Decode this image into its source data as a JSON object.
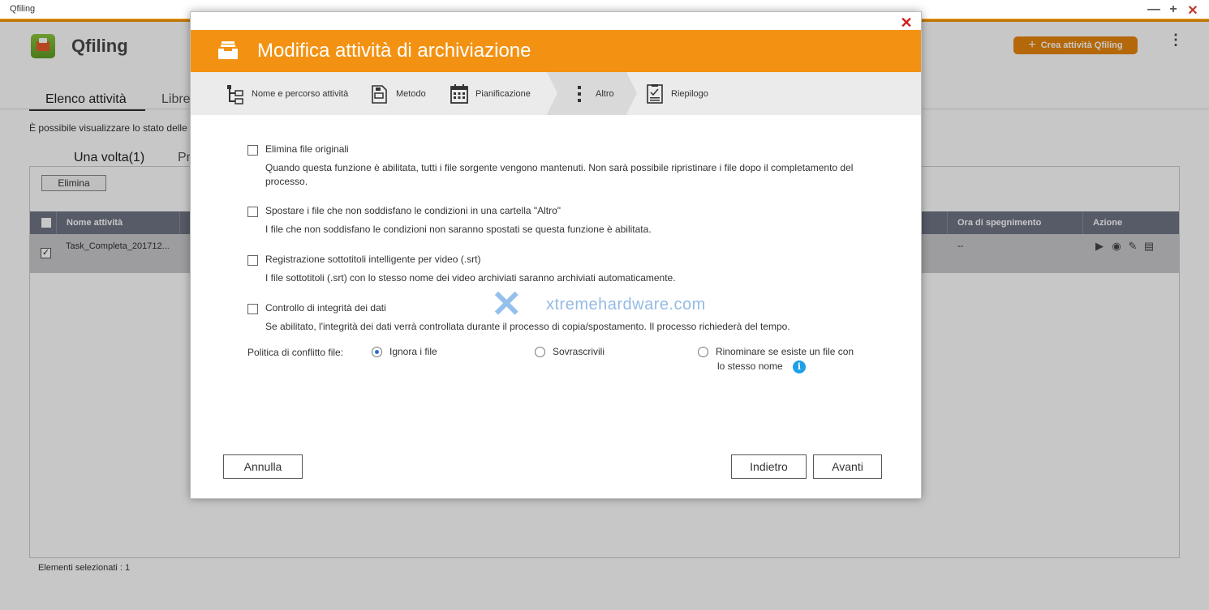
{
  "window": {
    "title": "Qfiling",
    "controls": {
      "minimize": "—",
      "maximize": "+",
      "close": "✕"
    }
  },
  "app": {
    "name": "Qfiling",
    "create_button": "Crea attività Qfiling",
    "main_tabs": [
      "Elenco attività",
      "Libre"
    ],
    "info_text": "È possibile visualizzare lo stato delle",
    "sub_tabs": [
      "Una volta(1)",
      "Pr"
    ],
    "delete_button": "Elimina",
    "table": {
      "columns": [
        "Nome attività",
        "Ora di spegnimento",
        "Azione"
      ],
      "rows": [
        {
          "name": "Task_Completa_201712...",
          "shutdown_time": "--",
          "checked": true
        }
      ]
    },
    "status": "Elementi selezionati : 1"
  },
  "dialog": {
    "title": "Modifica attività di archiviazione",
    "close": "✕",
    "steps": [
      {
        "label": "Nome e percorso attività",
        "icon": "folder-tree-icon"
      },
      {
        "label": "Metodo",
        "icon": "document-method-icon"
      },
      {
        "label": "Pianificazione",
        "icon": "calendar-icon"
      },
      {
        "label": "Altro",
        "icon": "more-vertical-icon",
        "active": true
      },
      {
        "label": "Riepilogo",
        "icon": "checklist-icon"
      }
    ],
    "options": [
      {
        "label": "Elimina file originali",
        "description": "Quando questa funzione è abilitata, tutti i file sorgente vengono mantenuti. Non sarà possibile ripristinare i file dopo il completamento del processo."
      },
      {
        "label": "Spostare i file che non soddisfano le condizioni in una cartella \"Altro\"",
        "description": "I file che non soddisfano le condizioni non saranno spostati se questa funzione è abilitata."
      },
      {
        "label": "Registrazione sottotitoli intelligente per video (.srt)",
        "description": "I file sottotitoli (.srt) con lo stesso nome dei video archiviati saranno archiviati automaticamente."
      },
      {
        "label": "Controllo di integrità dei dati",
        "description": "Se abilitato, l'integrità dei dati verrà controllata durante il processo di copia/spostamento. Il processo richiederà del tempo."
      }
    ],
    "conflict_policy": {
      "label": "Politica di conflitto file:",
      "choices": [
        {
          "label": "Ignora i file",
          "selected": true
        },
        {
          "label": "Sovrascrivili",
          "selected": false
        },
        {
          "label_line1": "Rinominare se esiste un file con",
          "label_line2": "lo stesso nome",
          "selected": false
        }
      ],
      "info": "i"
    },
    "buttons": {
      "cancel": "Annulla",
      "back": "Indietro",
      "next": "Avanti"
    }
  },
  "watermark": {
    "text": "xtremehardware.com"
  },
  "colors": {
    "accent": "#f39212",
    "table_header": "#6f7585",
    "selected_row": "#c9cacc",
    "radio_selected": "#2b6fd6",
    "info": "#1ea0e6"
  }
}
